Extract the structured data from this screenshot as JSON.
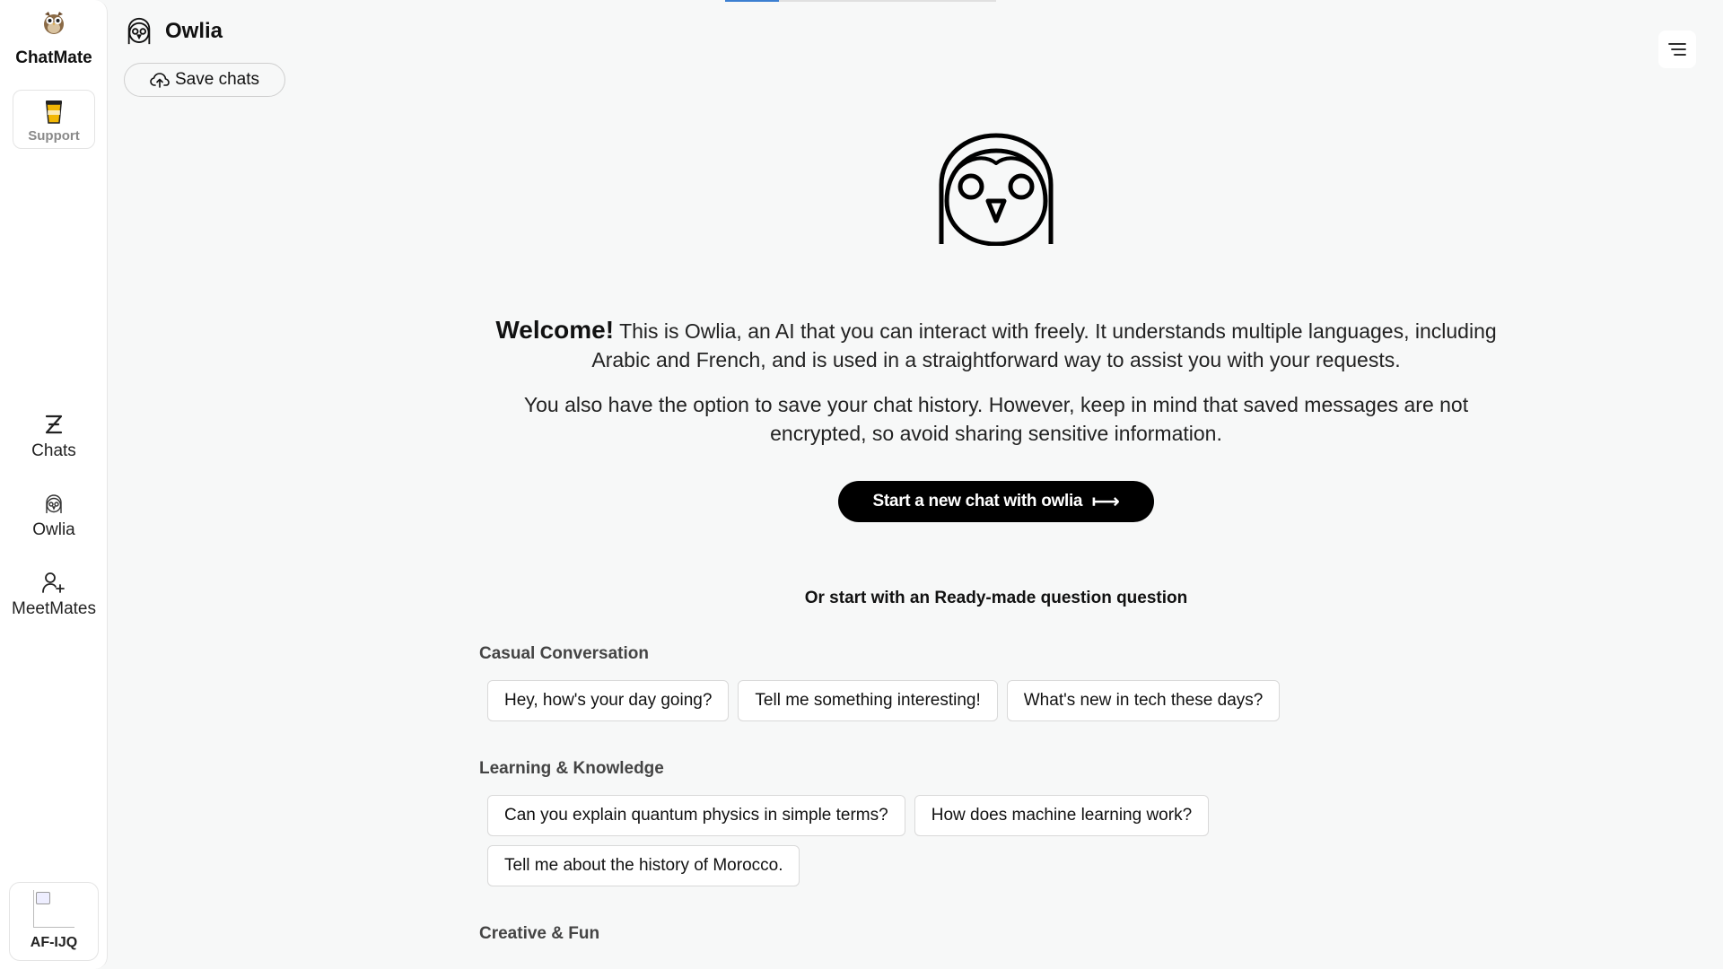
{
  "app": {
    "name": "ChatMate",
    "support_label": "Support"
  },
  "nav": [
    {
      "label": "Chats",
      "icon": "chats-icon"
    },
    {
      "label": "Owlia",
      "icon": "owl-icon"
    },
    {
      "label": "MeetMates",
      "icon": "add-user-icon"
    }
  ],
  "user": {
    "name": "AF-IJQ"
  },
  "header": {
    "title": "Owlia",
    "save_label": "Save chats"
  },
  "intro": {
    "welcome": "Welcome!",
    "paragraph1": "This is Owlia, an AI that you can interact with freely. It understands multiple languages, including Arabic and French, and is used in a straightforward way to assist you with your requests.",
    "paragraph2": "You also have the option to save your chat history. However, keep in mind that saved messages are not encrypted, so avoid sharing sensitive information."
  },
  "cta": {
    "label": "Start a new chat with owlia",
    "arrow": "⟼"
  },
  "ready_heading": "Or start with an Ready-made question question",
  "categories": [
    {
      "title": "Casual Conversation",
      "questions": [
        "Hey, how's your day going?",
        "Tell me something interesting!",
        "What's new in tech these days?"
      ]
    },
    {
      "title": "Learning & Knowledge",
      "questions": [
        "Can you explain quantum physics in simple terms?",
        "How does machine learning work?",
        "Tell me about the history of Morocco."
      ]
    },
    {
      "title": "Creative & Fun",
      "questions": []
    }
  ],
  "colors": {
    "accent": "#3c7fd1",
    "cta_bg": "#000000",
    "background": "#f7f8f8"
  }
}
